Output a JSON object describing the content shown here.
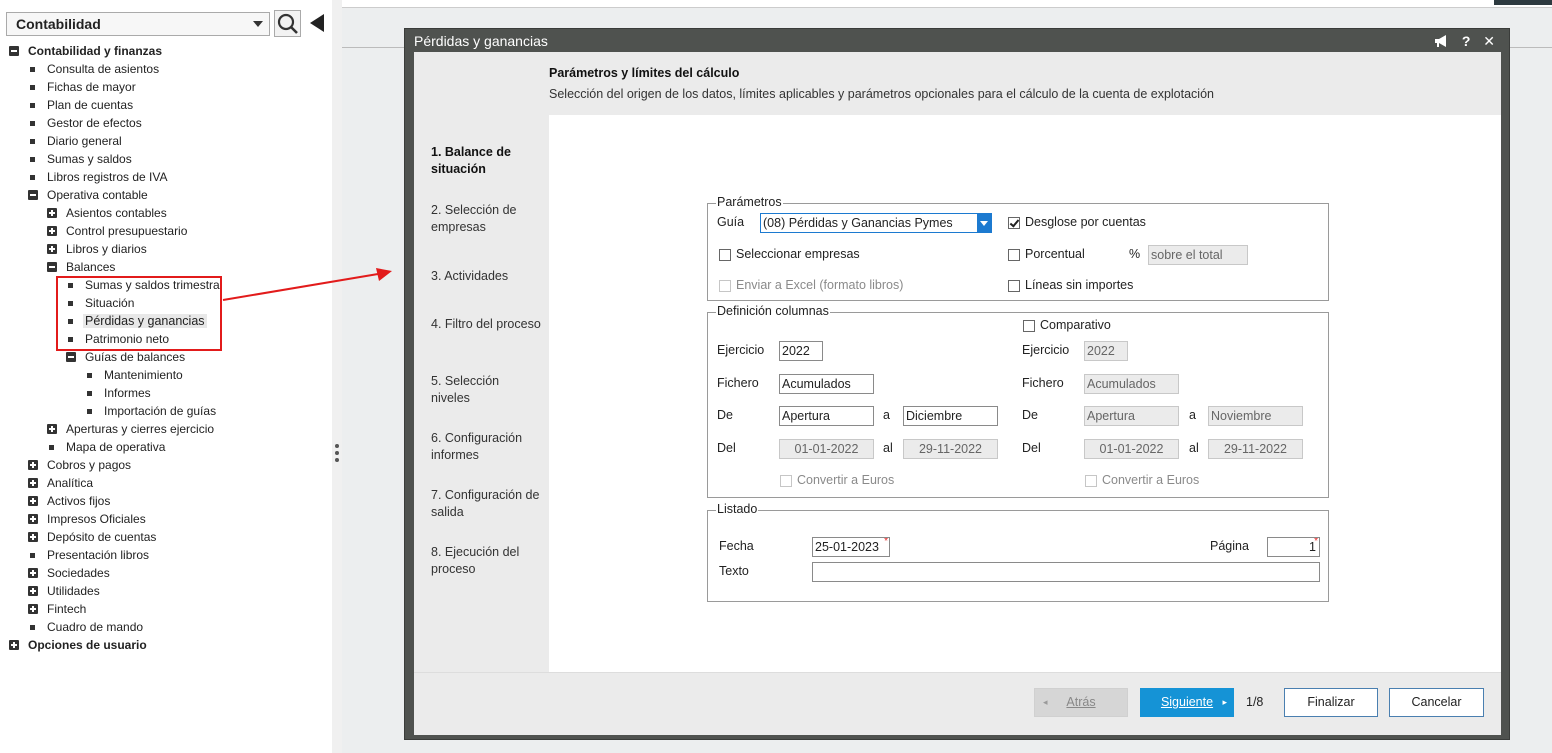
{
  "sidebar": {
    "module": "Contabilidad",
    "tree": [
      {
        "label": "Contabilidad y finanzas",
        "icon": "minus",
        "bold": true
      },
      {
        "label": "Consulta de asientos",
        "icon": "bullet"
      },
      {
        "label": "Fichas de mayor",
        "icon": "bullet"
      },
      {
        "label": "Plan de cuentas",
        "icon": "bullet"
      },
      {
        "label": "Gestor de efectos",
        "icon": "bullet"
      },
      {
        "label": "Diario general",
        "icon": "bullet"
      },
      {
        "label": "Sumas y saldos",
        "icon": "bullet"
      },
      {
        "label": "Libros registros de IVA",
        "icon": "bullet"
      },
      {
        "label": "Operativa contable",
        "icon": "minus"
      },
      {
        "label": "Asientos contables",
        "icon": "plus"
      },
      {
        "label": "Control presupuestario",
        "icon": "plus"
      },
      {
        "label": "Libros y diarios",
        "icon": "plus"
      },
      {
        "label": "Balances",
        "icon": "minus"
      },
      {
        "label": "Sumas y saldos trimestral",
        "icon": "bullet"
      },
      {
        "label": "Situación",
        "icon": "bullet"
      },
      {
        "label": "Pérdidas y ganancias",
        "icon": "bullet",
        "selected": true
      },
      {
        "label": "Patrimonio neto",
        "icon": "bullet"
      },
      {
        "label": "Guías de balances",
        "icon": "minus"
      },
      {
        "label": "Mantenimiento",
        "icon": "bullet"
      },
      {
        "label": "Informes",
        "icon": "bullet"
      },
      {
        "label": "Importación de guías",
        "icon": "bullet"
      },
      {
        "label": "Aperturas y cierres ejercicio",
        "icon": "plus"
      },
      {
        "label": "Mapa de operativa",
        "icon": "bullet"
      },
      {
        "label": "Cobros y pagos",
        "icon": "plus"
      },
      {
        "label": "Analítica",
        "icon": "plus"
      },
      {
        "label": "Activos fijos",
        "icon": "plus"
      },
      {
        "label": "Impresos Oficiales",
        "icon": "plus"
      },
      {
        "label": "Depósito de cuentas",
        "icon": "plus"
      },
      {
        "label": "Presentación libros",
        "icon": "bullet"
      },
      {
        "label": "Sociedades",
        "icon": "plus"
      },
      {
        "label": "Utilidades",
        "icon": "plus"
      },
      {
        "label": "Fintech",
        "icon": "plus"
      },
      {
        "label": "Cuadro de mando",
        "icon": "bullet"
      },
      {
        "label": "Opciones de usuario",
        "icon": "plus",
        "bold": true
      }
    ]
  },
  "dialog": {
    "title": "Pérdidas y ganancias",
    "title_icons": [
      "megaphone-icon",
      "help-icon",
      "close-icon"
    ],
    "header_title": "Parámetros y límites del cálculo",
    "header_subtitle": "Selección del origen de los datos, límites aplicables y parámetros opcionales para el cálculo de la cuenta de explotación",
    "steps": [
      {
        "label": "1. Balance de situación",
        "active": true
      },
      {
        "label": "2. Selección de empresas"
      },
      {
        "label": "3. Actividades"
      },
      {
        "label": "4. Filtro del proceso"
      },
      {
        "label": "5. Selección niveles"
      },
      {
        "label": "6. Configuración informes"
      },
      {
        "label": "7. Configuración de salida"
      },
      {
        "label": "8. Ejecución del proceso"
      }
    ],
    "parametros": {
      "legend": "Parámetros",
      "guia_label": "Guía",
      "guia_value": "(08) Pérdidas y Ganancias Pymes",
      "desglose_label": "Desglose por cuentas",
      "desglose_checked": true,
      "seleccionar_label": "Seleccionar empresas",
      "porcentual_label": "Porcentual",
      "percent_sign": "%",
      "porcentual_value": "sobre el total",
      "excel_label": "Enviar a Excel (formato libros)",
      "lineas_label": "Líneas sin importes"
    },
    "columnas": {
      "legend": "Definición columnas",
      "comparativo_label": "Comparativo",
      "ejercicio_label": "Ejercicio",
      "fichero_label": "Fichero",
      "de_label": "De",
      "a_label": "a",
      "del_label": "Del",
      "al_label": "al",
      "convertir_label": "Convertir a Euros",
      "left": {
        "ejercicio": "2022",
        "fichero": "Acumulados",
        "de": "Apertura",
        "a": "Diciembre",
        "del": "01-01-2022",
        "al": "29-11-2022"
      },
      "right": {
        "ejercicio": "2022",
        "fichero": "Acumulados",
        "de": "Apertura",
        "a": "Noviembre",
        "del": "01-01-2022",
        "al": "29-11-2022"
      }
    },
    "listado": {
      "legend": "Listado",
      "fecha_label": "Fecha",
      "fecha_value": "25-01-2023",
      "pagina_label": "Página",
      "pagina_value": "1",
      "texto_label": "Texto",
      "texto_value": "",
      "required_mark": "*"
    },
    "footer": {
      "back": "Atrás",
      "next": "Siguiente",
      "page_count": "1/8",
      "finish": "Finalizar",
      "cancel": "Cancelar"
    }
  },
  "colors": {
    "accent": "#1593d6",
    "highlight": "#e21b1b",
    "dialog_frame": "#4f524f"
  }
}
